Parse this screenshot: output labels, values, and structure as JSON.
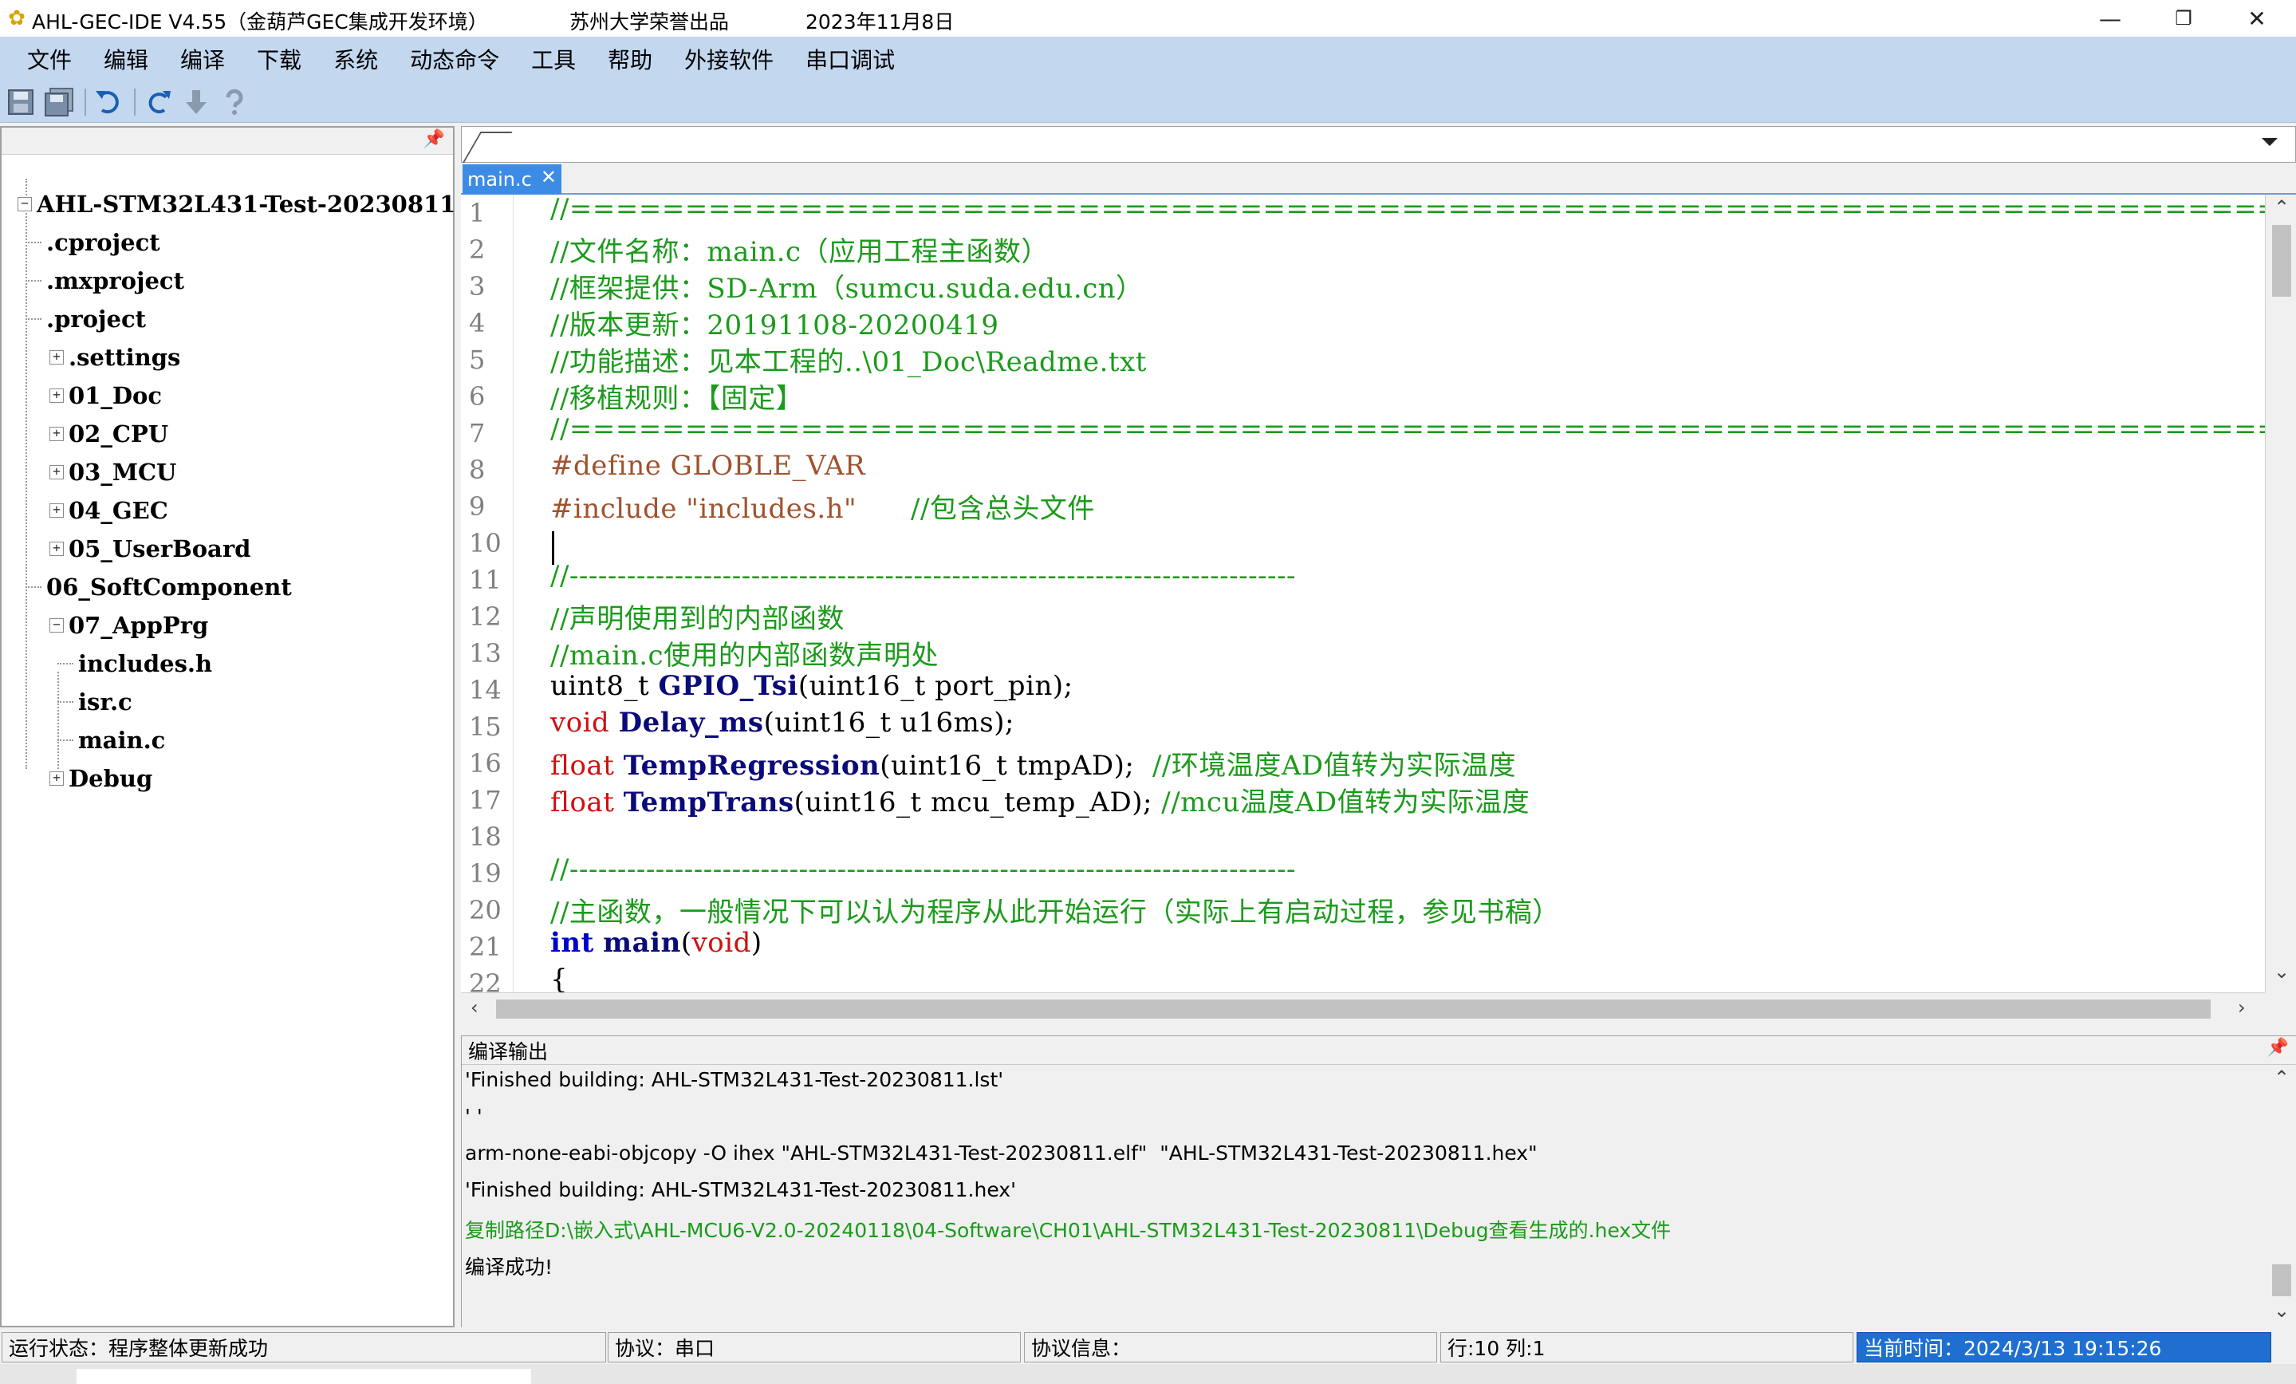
{
  "titlebar": {
    "app": "AHL-GEC-IDE V4.55（金葫芦GEC集成开发环境）",
    "org": "苏州大学荣誉出品",
    "date": "2023年11月8日",
    "minimize": "—",
    "restore": "❐",
    "close": "✕"
  },
  "menu": [
    "文件",
    "编辑",
    "编译",
    "下载",
    "系统",
    "动态命令",
    "工具",
    "帮助",
    "外接软件",
    "串口调试"
  ],
  "toolbar": {
    "icons": [
      "save-icon",
      "save-all-icon",
      "undo-icon",
      "redo-icon",
      "download-icon",
      "help-icon"
    ],
    "accent": "#1a5fb4"
  },
  "project_tree": {
    "root": "AHL-STM32L431-Test-20230811",
    "items": [
      {
        "label": ".cproject",
        "expandable": false
      },
      {
        "label": ".mxproject",
        "expandable": false
      },
      {
        "label": ".project",
        "expandable": false
      },
      {
        "label": ".settings",
        "expandable": true
      },
      {
        "label": "01_Doc",
        "expandable": true
      },
      {
        "label": "02_CPU",
        "expandable": true
      },
      {
        "label": "03_MCU",
        "expandable": true
      },
      {
        "label": "04_GEC",
        "expandable": true
      },
      {
        "label": "05_UserBoard",
        "expandable": true
      },
      {
        "label": "06_SoftComponent",
        "expandable": false
      },
      {
        "label": "07_AppPrg",
        "expandable": true,
        "expanded": true
      },
      {
        "label": "includes.h",
        "expandable": false
      },
      {
        "label": "isr.c",
        "expandable": false
      },
      {
        "label": "main.c",
        "expandable": false
      },
      {
        "label": "Debug",
        "expandable": true
      }
    ]
  },
  "editor": {
    "tab": "main.c",
    "tab_close": "✕",
    "lines": [
      {
        "n": "1",
        "text": "//============================================================================"
      },
      {
        "n": "2",
        "text": "//文件名称：main.c（应用工程主函数）"
      },
      {
        "n": "3",
        "text": "//框架提供：SD-Arm（sumcu.suda.edu.cn）"
      },
      {
        "n": "4",
        "text": "//版本更新：20191108-20200419"
      },
      {
        "n": "5",
        "text": "//功能描述：见本工程的..\\01_Doc\\Readme.txt"
      },
      {
        "n": "6",
        "text": "//移植规则：【固定】"
      },
      {
        "n": "7",
        "text": "//============================================================================"
      },
      {
        "n": "8",
        "text": "#define GLOBLE_VAR"
      },
      {
        "n": "9",
        "text": "#include \"includes.h\"      //包含总头文件"
      },
      {
        "n": "10",
        "text": ""
      },
      {
        "n": "11",
        "text": "//----------------------------------------------------------------------------"
      },
      {
        "n": "12",
        "text": "//声明使用到的内部函数"
      },
      {
        "n": "13",
        "text": "//main.c使用的内部函数声明处"
      },
      {
        "n": "14",
        "text": "uint8_t GPIO_Tsi(uint16_t port_pin);"
      },
      {
        "n": "15",
        "text": "void Delay_ms(uint16_t u16ms);"
      },
      {
        "n": "16",
        "text": "float TempRegression(uint16_t tmpAD);  //环境温度AD值转为实际温度"
      },
      {
        "n": "17",
        "text": "float TempTrans(uint16_t mcu_temp_AD); //mcu温度AD值转为实际温度"
      },
      {
        "n": "18",
        "text": ""
      },
      {
        "n": "19",
        "text": "//----------------------------------------------------------------------------"
      },
      {
        "n": "20",
        "text": "//主函数，一般情况下可以认为程序从此开始运行（实际上有启动过程，参见书稿）"
      },
      {
        "n": "21",
        "text": "int main(void)"
      },
      {
        "n": "22",
        "text": "{"
      }
    ]
  },
  "output": {
    "title": "编译输出",
    "lines": [
      {
        "text": "'Finished building: AHL-STM32L431-Test-20230811.lst'",
        "color": "#000000"
      },
      {
        "text": "' '",
        "color": "#000000"
      },
      {
        "text": "arm-none-eabi-objcopy -O ihex \"AHL-STM32L431-Test-20230811.elf\"  \"AHL-STM32L431-Test-20230811.hex\"",
        "color": "#000000"
      },
      {
        "text": "'Finished building: AHL-STM32L431-Test-20230811.hex'",
        "color": "#000000"
      },
      {
        "text": "复制路径D:\\嵌入式\\AHL-MCU6-V2.0-20240118\\04-Software\\CH01\\AHL-STM32L431-Test-20230811\\Debug查看生成的.hex文件",
        "color": "#1b9b1b"
      },
      {
        "text": "编译成功!",
        "color": "#000000"
      }
    ]
  },
  "status": {
    "run": "运行状态：程序整体更新成功",
    "protocol": "协议：串口",
    "protocol_info": "协议信息：",
    "position": "行:10 列:1",
    "time": "当前时间：2024/3/13 19:15:26"
  },
  "colors": {
    "menu_bg": "#c3d7ef",
    "comment": "#1b9b1b",
    "keyword": "#d01010",
    "tab_active": "#3c8ce6",
    "status_time_bg": "#1f6fd1"
  }
}
